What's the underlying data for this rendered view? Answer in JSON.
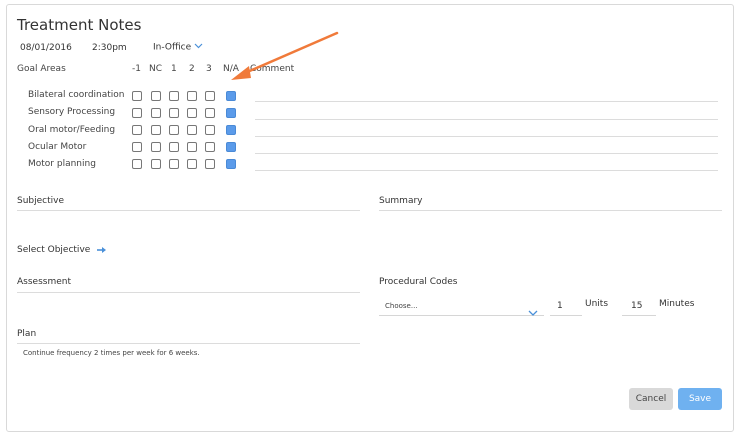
{
  "header": {
    "title": "Treatment Notes",
    "date": "08/01/2016",
    "time": "2:30pm",
    "location": "In-Office"
  },
  "goals_table": {
    "goal_areas_label": "Goal Areas",
    "columns": [
      "-1",
      "NC",
      "1",
      "2",
      "3",
      "N/A"
    ],
    "comment_label": "Comment",
    "rows": [
      {
        "label": "Bilateral coordination",
        "checked": "N/A"
      },
      {
        "label": "Sensory Processing",
        "checked": "N/A"
      },
      {
        "label": "Oral motor/Feeding",
        "checked": "N/A"
      },
      {
        "label": "Ocular Motor",
        "checked": "N/A"
      },
      {
        "label": "Motor planning",
        "checked": "N/A"
      }
    ]
  },
  "sections": {
    "subjective": "Subjective",
    "summary": "Summary",
    "select_objective": "Select Objective",
    "assessment": "Assessment",
    "procedural_codes": "Procedural Codes",
    "plan": "Plan",
    "plan_text": "Continue frequency 2 times per week for 6 weeks."
  },
  "procedural": {
    "choose_placeholder": "Choose...",
    "units_value": "1",
    "units_label": "Units",
    "minutes_value": "15",
    "minutes_label": "Minutes"
  },
  "buttons": {
    "cancel": "Cancel",
    "save": "Save"
  },
  "colors": {
    "accent": "#5b9bea",
    "annotation_arrow": "#f07a3a",
    "save_button": "#6fb1f0"
  }
}
